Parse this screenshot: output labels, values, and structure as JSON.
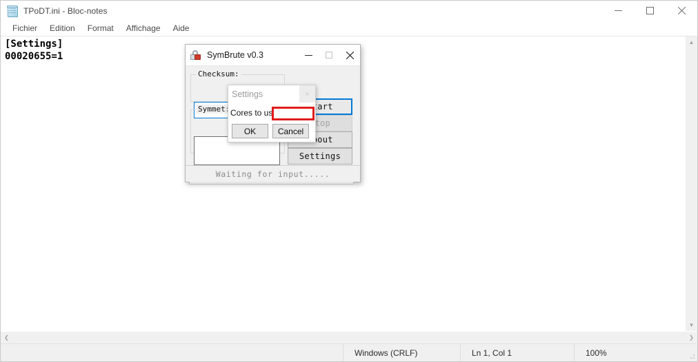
{
  "notepad": {
    "title": "TPoDT.ini - Bloc-notes",
    "icon": "notepad-icon",
    "menu": [
      {
        "label": "Fichier"
      },
      {
        "label": "Edition"
      },
      {
        "label": "Format"
      },
      {
        "label": "Affichage"
      },
      {
        "label": "Aide"
      }
    ],
    "window_controls": {
      "minimize": "minimize-icon",
      "maximize": "maximize-icon",
      "close": "close-icon"
    },
    "document_text": "[Settings]\n00020655=1",
    "scrollbar": {
      "up_arrow": "▲",
      "down_arrow": "▼",
      "left_arrow": "❮",
      "right_arrow": "❯"
    },
    "statusbar": {
      "line_ending": "Windows (CRLF)",
      "caret_position": "Ln 1, Col 1",
      "zoom": "100%"
    }
  },
  "symbrute": {
    "title": "SymBrute v0.3",
    "icon": "padlock-icon",
    "window_controls": {
      "minimize": "minimize-icon",
      "maximize": "maximize-icon",
      "close": "close-icon"
    },
    "groups": {
      "checksum_label": "Checksum:",
      "symmetry_label": "Symmet:"
    },
    "fields": {
      "checksum_value": "",
      "checksum_placeholder": "",
      "symmetry_value": "",
      "symmetry_placeholder": ""
    },
    "buttons": {
      "start": "Start",
      "stop": "Stop",
      "about": "About",
      "settings": "Settings"
    },
    "progress": {
      "percent": 0
    },
    "status_text": "Waiting for input....."
  },
  "settings_dialog": {
    "title": "Settings",
    "close_label": "×",
    "cores_label": "Cores to use:",
    "cores_value": "",
    "cores_placeholder": "",
    "ok_label": "OK",
    "cancel_label": "Cancel",
    "highlight_color": "#e01b1b"
  }
}
